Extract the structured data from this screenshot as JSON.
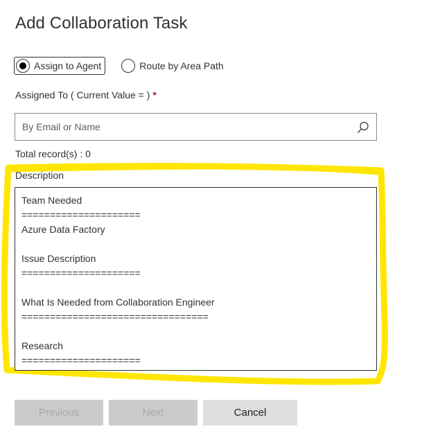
{
  "dialog": {
    "title": "Add Collaboration Task"
  },
  "assignment": {
    "options": [
      {
        "label": "Assign to Agent",
        "selected": true
      },
      {
        "label": "Route by Area Path",
        "selected": false
      }
    ]
  },
  "assigned_to": {
    "label": "Assigned To ( Current Value = )",
    "required_marker": "*",
    "placeholder": "By Email or Name",
    "value": "",
    "search_icon": "search-icon"
  },
  "records": {
    "text": "Total record(s) : 0"
  },
  "description": {
    "label": "Description",
    "lines": [
      "Team Needed",
      "=====================",
      "Azure Data Factory",
      "",
      "Issue Description",
      "=====================",
      "",
      "What Is Needed from Collaboration Engineer",
      "=================================",
      "",
      "Research",
      "====================="
    ]
  },
  "buttons": {
    "previous": "Previous",
    "next": "Next",
    "cancel": "Cancel"
  },
  "colors": {
    "highlight": "#ffe600",
    "required": "#a4262c",
    "disabled_bg": "#c8c6c4",
    "cancel_bg": "#e1dfdd"
  }
}
